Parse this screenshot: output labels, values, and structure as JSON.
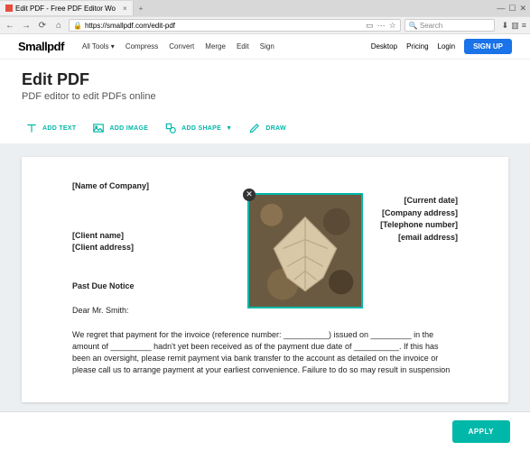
{
  "browser": {
    "tab_title": "Edit PDF - Free PDF Editor Wo",
    "url": "https://smallpdf.com/edit-pdf",
    "search_placeholder": "Search"
  },
  "header": {
    "logo": "Smallpdf",
    "nav": {
      "all_tools": "All Tools",
      "compress": "Compress",
      "convert": "Convert",
      "merge": "Merge",
      "edit": "Edit",
      "sign": "Sign"
    },
    "right": {
      "desktop": "Desktop",
      "pricing": "Pricing",
      "login": "Login",
      "signup": "SIGN UP"
    }
  },
  "page": {
    "title": "Edit PDF",
    "subtitle": "PDF editor to edit PDFs online"
  },
  "toolbar": {
    "add_text": "ADD TEXT",
    "add_image": "ADD IMAGE",
    "add_shape": "ADD SHAPE",
    "draw": "DRAW"
  },
  "document": {
    "company": "[Name of Company]",
    "right": {
      "date": "[Current date]",
      "address": "[Company address]",
      "phone": "[Telephone number]",
      "email": "[email address]"
    },
    "client_name": "[Client name]",
    "client_address": "[Client address]",
    "notice": "Past Due Notice",
    "salutation": "Dear Mr. Smith:",
    "body": "We regret that payment for the invoice (reference number: __________) issued on _________ in the amount of _________ hadn't yet been received as of the payment due date of __________. If this has been an oversight, please remit payment via bank transfer to the account as detailed on the invoice or please call us to arrange payment at your earliest convenience. Failure to do so may result in suspension"
  },
  "actions": {
    "apply": "APPLY"
  },
  "colors": {
    "accent": "#00b8a9",
    "primary_blue": "#1a73e8"
  }
}
